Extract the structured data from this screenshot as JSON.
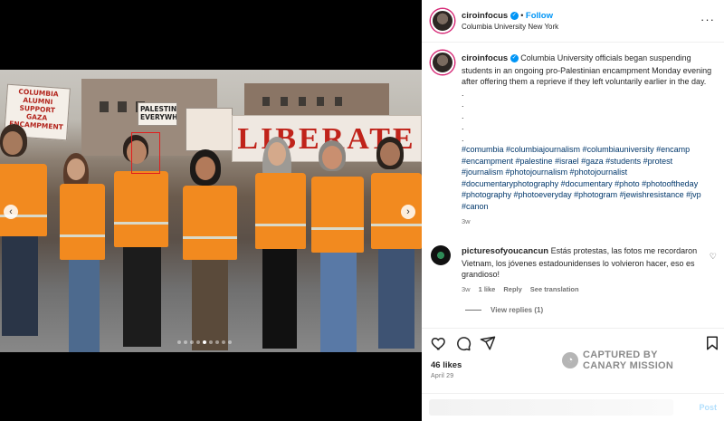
{
  "post": {
    "username": "ciroinfocus",
    "follow_label": "Follow",
    "location": "Columbia University New York",
    "caption_text": "Columbia University officials began suspending students in an ongoing pro-Palestinian encampment Monday evening after offering them a reprieve if they left voluntarily earlier in the day.",
    "dots": [
      ".",
      ".",
      ".",
      ".",
      "."
    ],
    "hashtags": "#comumbia #columbiajournalism #columbiauniversity #encamp #encampment #palestine #israel #gaza #students #protest #journalism #photojournalism #photojournalist #documentaryphotography #documentary #photo #photooftheday #photography #photoeveryday #photogram #jewishresistance #jvp #canon",
    "caption_age": "3w",
    "likes": "46 likes",
    "date": "April 29",
    "post_label": "Post"
  },
  "comment": {
    "username": "picturesofyoucancun",
    "text": "Estás protestas, las fotos me recordaron Vietnam, los jóvenes estadounidenses lo volvieron hacer, eso es grandioso!",
    "age": "3w",
    "likes": "1 like",
    "reply": "Reply",
    "translate": "See translation",
    "view_replies": "View replies (1)"
  },
  "photo_signs": {
    "sign1": "COLUMBIA ALUMNI SUPPORT GAZA ENCAMPMENT",
    "sign2": "PALESTINE EVERYWHERE",
    "banner": "LIBERATE"
  },
  "carousel": {
    "count": 9,
    "active": 4
  },
  "watermark": {
    "line1": "CAPTURED BY",
    "line2": "CANARY MISSION"
  },
  "colors": {
    "accent": "#0095f6",
    "vest": "#f28a1f",
    "hashtag": "#00376b"
  }
}
